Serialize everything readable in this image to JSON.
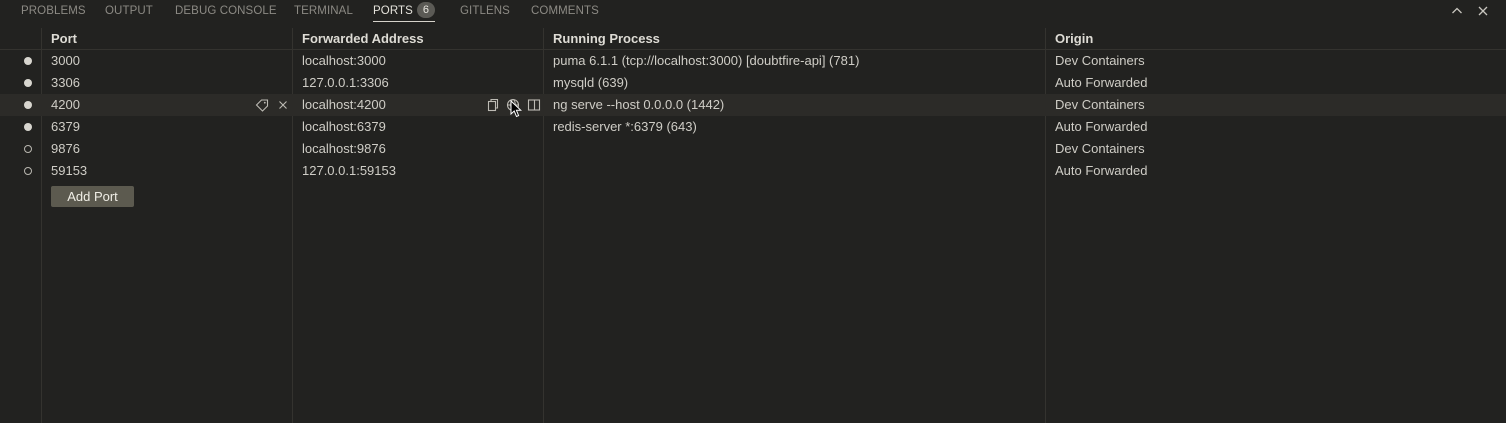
{
  "tabs": [
    {
      "label": "PROBLEMS"
    },
    {
      "label": "OUTPUT"
    },
    {
      "label": "DEBUG CONSOLE"
    },
    {
      "label": "TERMINAL"
    },
    {
      "label": "PORTS",
      "badge": "6",
      "active": true
    },
    {
      "label": "GITLENS"
    },
    {
      "label": "COMMENTS"
    }
  ],
  "columns": {
    "port": "Port",
    "address": "Forwarded Address",
    "process": "Running Process",
    "origin": "Origin"
  },
  "rows": [
    {
      "status": "running",
      "port": "3000",
      "address": "localhost:3000",
      "process": "puma 6.1.1 (tcp://localhost:3000) [doubtfire-api] (781)",
      "origin": "Dev Containers"
    },
    {
      "status": "running",
      "port": "3306",
      "address": "127.0.0.1:3306",
      "process": "mysqld (639)",
      "origin": "Auto Forwarded"
    },
    {
      "status": "running",
      "port": "4200",
      "address": "localhost:4200",
      "process": "ng serve --host 0.0.0.0 (1442)",
      "origin": "Dev Containers",
      "hovered": true
    },
    {
      "status": "running",
      "port": "6379",
      "address": "localhost:6379",
      "process": "redis-server *:6379 (643)",
      "origin": "Auto Forwarded"
    },
    {
      "status": "inactive",
      "port": "9876",
      "address": "localhost:9876",
      "process": "",
      "origin": "Dev Containers"
    },
    {
      "status": "inactive",
      "port": "59153",
      "address": "127.0.0.1:59153",
      "process": "",
      "origin": "Auto Forwarded"
    }
  ],
  "add_port_label": "Add Port",
  "icons": {
    "maximize": "chevron-up-icon",
    "close": "close-icon",
    "row_label": "tag-icon",
    "row_stop": "close-icon",
    "copy_address": "copy-icon",
    "open_browser": "globe-icon",
    "preview": "preview-icon"
  },
  "colors": {
    "background": "#222220",
    "text": "#cfcdc6",
    "button": "#5c5a4f",
    "hover_row": "#2c2b28"
  }
}
